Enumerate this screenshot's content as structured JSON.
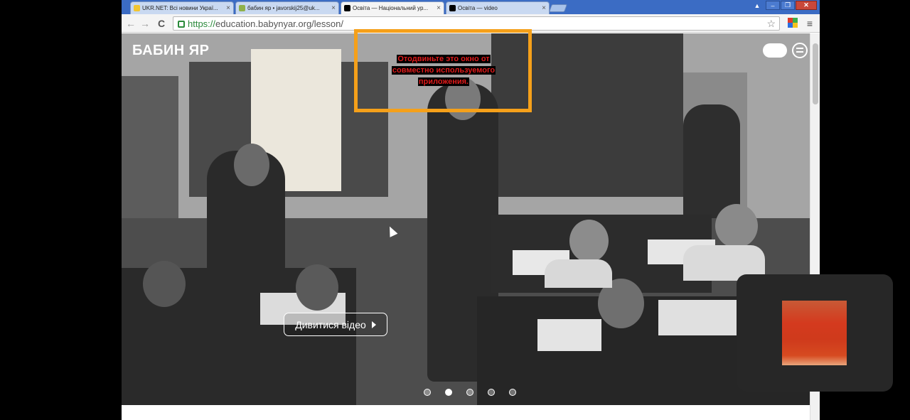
{
  "tabs": [
    {
      "title": "UKR.NET: Всі новини Украї...",
      "favicon_color": "#f2c531",
      "active": false
    },
    {
      "title": "бабин яр • javorskij25@uk...",
      "favicon_color": "#8fb14a",
      "active": false
    },
    {
      "title": "Освіта — Національний ур...",
      "favicon_color": "#000000",
      "active": true
    },
    {
      "title": "Освіта — video",
      "favicon_color": "#000000",
      "active": false
    }
  ],
  "window_controls": {
    "user": "▲",
    "minimize": "–",
    "maximize": "❐",
    "close": "✕"
  },
  "toolbar": {
    "back": "←",
    "forward": "→",
    "reload": "C",
    "url_scheme": "https://",
    "url_rest": "education.babynyar.org/lesson/",
    "star": "☆",
    "menu": "≡"
  },
  "page": {
    "logo": "БАБИН ЯР",
    "watch_button": "Дивитися відео",
    "dots": [
      false,
      true,
      false,
      false,
      false
    ]
  },
  "overlay": {
    "warning_lines": [
      "Отодвиньте это окно от",
      "совместно используемого",
      "приложения."
    ],
    "accent_color": "#f5a01a",
    "text_color": "#e01b1b"
  },
  "icons": [
    "lock-icon",
    "star-icon",
    "extension-icon",
    "chrome-menu-icon",
    "play-icon",
    "menu-icon",
    "toggle-icon"
  ]
}
